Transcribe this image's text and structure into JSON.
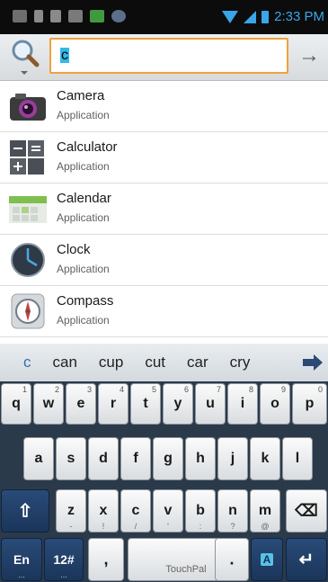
{
  "status_bar": {
    "time": "2:33 PM"
  },
  "search": {
    "query": "c",
    "go_label": "→"
  },
  "apps": [
    {
      "name": "Camera",
      "type": "Application",
      "icon": "camera-icon"
    },
    {
      "name": "Calculator",
      "type": "Application",
      "icon": "calculator-icon"
    },
    {
      "name": "Calendar",
      "type": "Application",
      "icon": "calendar-icon"
    },
    {
      "name": "Clock",
      "type": "Application",
      "icon": "clock-icon"
    },
    {
      "name": "Compass",
      "type": "Application",
      "icon": "compass-icon"
    }
  ],
  "keyboard": {
    "suggestions": [
      "c",
      "can",
      "cup",
      "cut",
      "car",
      "cry"
    ],
    "row1": [
      {
        "key": "q",
        "alt": "1"
      },
      {
        "key": "w",
        "alt": "2"
      },
      {
        "key": "e",
        "alt": "3"
      },
      {
        "key": "r",
        "alt": "4"
      },
      {
        "key": "t",
        "alt": "5"
      },
      {
        "key": "y",
        "alt": "6"
      },
      {
        "key": "u",
        "alt": "7"
      },
      {
        "key": "i",
        "alt": "8"
      },
      {
        "key": "o",
        "alt": "9"
      },
      {
        "key": "p",
        "alt": "0"
      }
    ],
    "row2": [
      "a",
      "s",
      "d",
      "f",
      "g",
      "h",
      "j",
      "k",
      "l"
    ],
    "row3": [
      {
        "key": "z",
        "alt": "-"
      },
      {
        "key": "x",
        "alt": "!"
      },
      {
        "key": "c",
        "alt": "/"
      },
      {
        "key": "v",
        "alt": "'"
      },
      {
        "key": "b",
        "alt": ":"
      },
      {
        "key": "n",
        "alt": "?"
      },
      {
        "key": "m",
        "alt": "@"
      }
    ],
    "shift_label": "⇧",
    "backspace_label": "⌫",
    "lang_label": "En",
    "symbols_label": "12#",
    "comma_label": ",",
    "space_label": "TouchPal",
    "period_label": ".",
    "mode_label": "A",
    "enter_label": "↵"
  },
  "colors": {
    "accent": "#f0a13b",
    "highlight": "#34b8e8",
    "status_blue": "#3aa6e8",
    "key_dark": "#1f3d66"
  }
}
